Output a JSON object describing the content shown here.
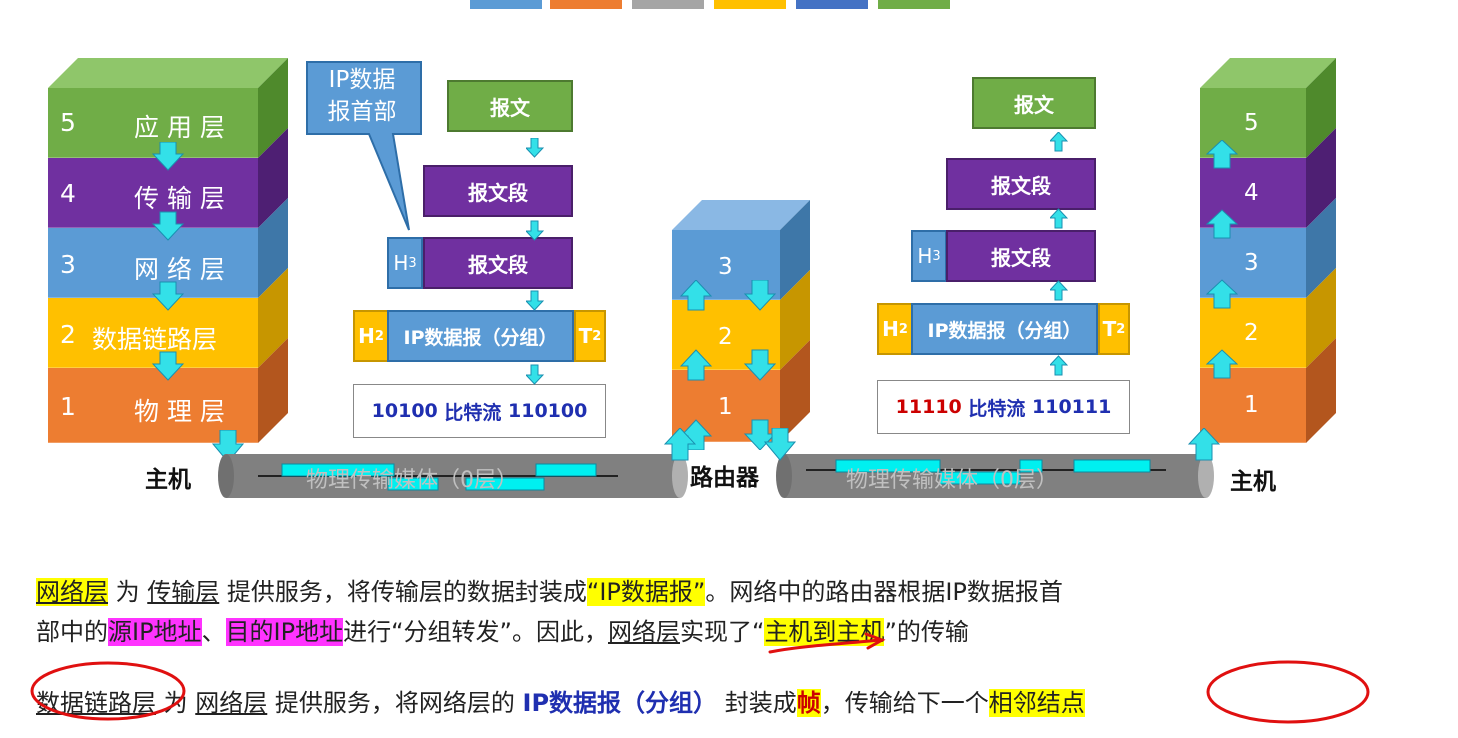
{
  "legend_stripes": [
    {
      "color": "#5b9bd5"
    },
    {
      "color": "#ed7d31"
    },
    {
      "color": "#a5a5a5"
    },
    {
      "color": "#ffc000"
    },
    {
      "color": "#4472c4"
    },
    {
      "color": "#70ad47"
    }
  ],
  "left_host": {
    "label": "主机",
    "layers": [
      {
        "num": "5",
        "name": "应 用 层",
        "color": "#70ad47"
      },
      {
        "num": "4",
        "name": "传 输 层",
        "color": "#7030a0"
      },
      {
        "num": "3",
        "name": "网 络 层",
        "color": "#5b9bd5"
      },
      {
        "num": "2",
        "name": "数据链路层",
        "color": "#ffc000"
      },
      {
        "num": "1",
        "name": "物 理 层",
        "color": "#ed7d31"
      }
    ]
  },
  "router": {
    "label": "路由器",
    "layers": [
      {
        "num": "3"
      },
      {
        "num": "2"
      },
      {
        "num": "1"
      }
    ]
  },
  "right_host": {
    "label": "主机",
    "layers": [
      {
        "num": "5"
      },
      {
        "num": "4"
      },
      {
        "num": "3"
      },
      {
        "num": "2"
      },
      {
        "num": "1"
      }
    ]
  },
  "callout": {
    "line1": "IP数据",
    "line2": "报首部"
  },
  "left_encap": {
    "message": "报文",
    "segment": "报文段",
    "h3": "H",
    "h3_sub": "3",
    "h3_segment": "报文段",
    "h2": "H",
    "h2_sub": "2",
    "datagram": "IP数据报（分组）",
    "t2": "T",
    "t2_sub": "2",
    "bits_a": "10100",
    "bits_mid": " 比特流 ",
    "bits_b": "110100"
  },
  "right_encap": {
    "message": "报文",
    "segment": "报文段",
    "h3": "H",
    "h3_sub": "3",
    "h3_segment": "报文段",
    "h2": "H",
    "h2_sub": "2",
    "datagram": "IP数据报（分组）",
    "t2": "T",
    "t2_sub": "2",
    "bits_a": "11110",
    "bits_mid": " 比特流 ",
    "bits_b": "110111"
  },
  "medium_left": "物理传输媒体（0层）",
  "medium_right": "物理传输媒体（0层）",
  "para1": {
    "a": "网络层",
    "b": " 为 ",
    "c": "传输层",
    "d": " 提供服务，将传输层的数据封装成",
    "e": "“IP数据报”",
    "f": "。网络中的路由器根据IP数据报首"
  },
  "para2": {
    "a": "部中的",
    "b": "源IP地址",
    "c": "、",
    "d": "目的IP地址",
    "e": "进行“分组转发”。因此，",
    "f": "网络层",
    "g": "实现了“",
    "h": "主机到主机",
    "i": "”的传输"
  },
  "para3": {
    "a": "数据链路层",
    "b": " 为 ",
    "c": "网络层",
    "d": " 提供服务，将网络层的 ",
    "e": "IP数据报（分组）",
    "f": " 封装成",
    "g": "帧",
    "h": "，传输给下一个",
    "i": "相邻结点"
  }
}
